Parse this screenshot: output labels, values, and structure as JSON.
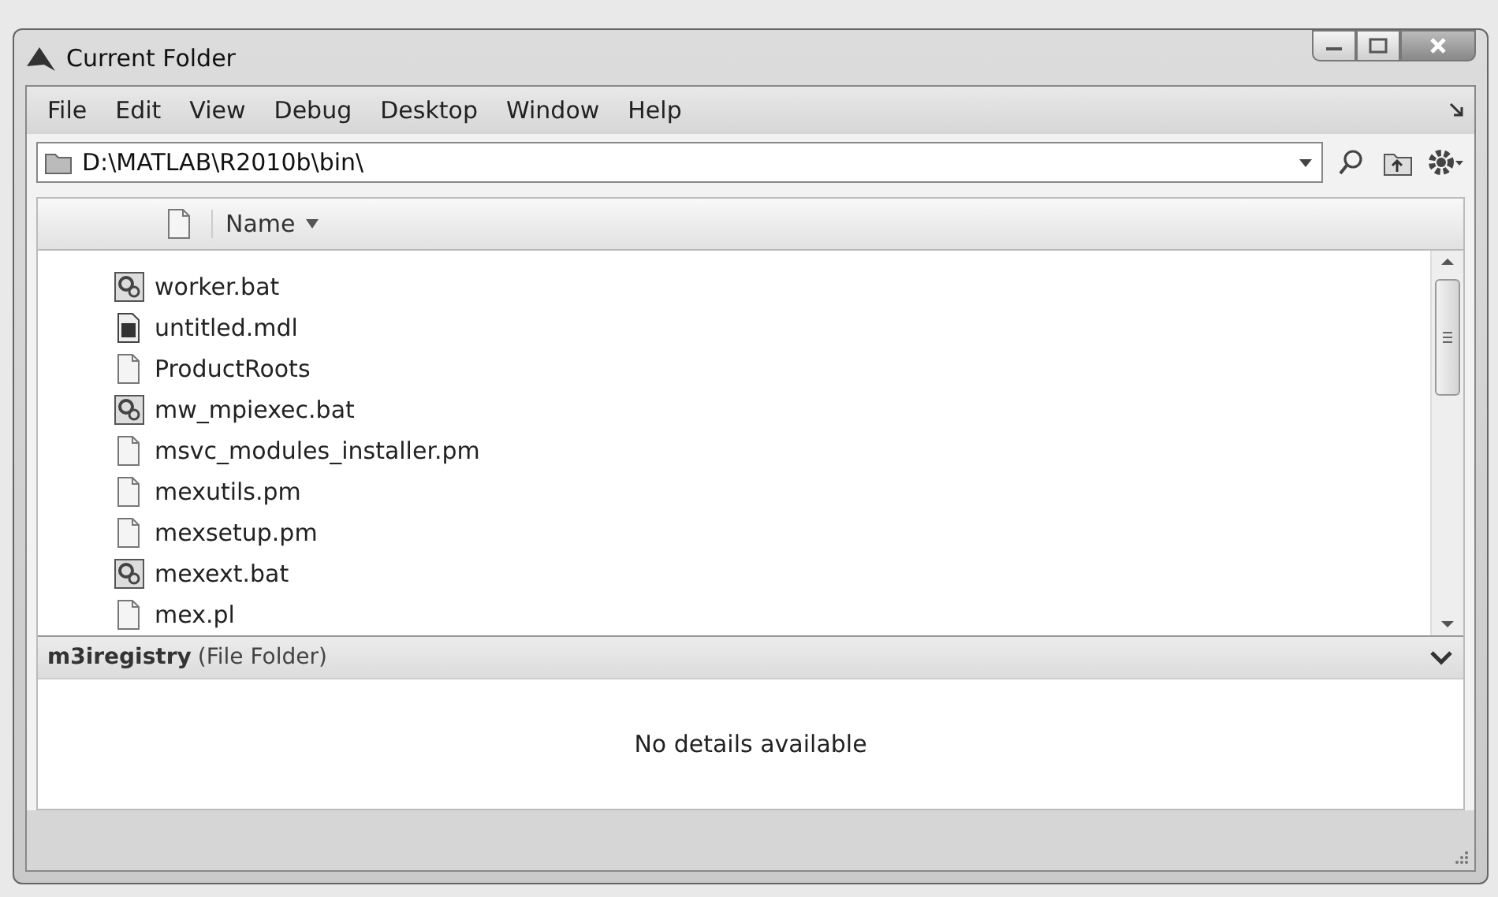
{
  "window": {
    "title": "Current Folder"
  },
  "menu": [
    "File",
    "Edit",
    "View",
    "Debug",
    "Desktop",
    "Window",
    "Help"
  ],
  "address": {
    "value": "D:\\MATLAB\\R2010b\\bin\\"
  },
  "columns": [
    {
      "label": "Name",
      "sorted": true
    }
  ],
  "files": [
    {
      "name": "worker.bat",
      "kind": "batch"
    },
    {
      "name": "untitled.mdl",
      "kind": "model"
    },
    {
      "name": "ProductRoots",
      "kind": "plain"
    },
    {
      "name": "mw_mpiexec.bat",
      "kind": "batch"
    },
    {
      "name": "msvc_modules_installer.pm",
      "kind": "plain"
    },
    {
      "name": "mexutils.pm",
      "kind": "plain"
    },
    {
      "name": "mexsetup.pm",
      "kind": "plain"
    },
    {
      "name": "mexext.bat",
      "kind": "batch"
    },
    {
      "name": "mex.pl",
      "kind": "plain"
    }
  ],
  "details": {
    "name": "m3iregistry",
    "type": "(File Folder)",
    "message": "No details available"
  }
}
